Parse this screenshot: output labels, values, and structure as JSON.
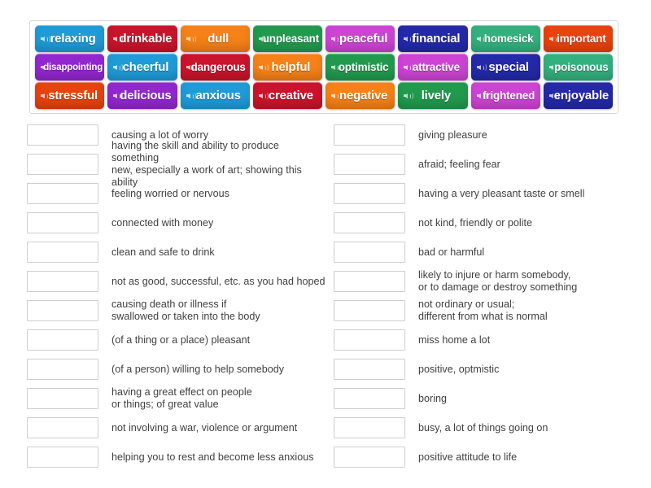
{
  "activity": {
    "type": "match-up",
    "icon_name": "speaker-icon",
    "tile_rows": [
      [
        {
          "label": "relaxing",
          "color": "#1f9bd8",
          "size": "normal"
        },
        {
          "label": "drinkable",
          "color": "#c9142b",
          "size": "normal"
        },
        {
          "label": "dull",
          "color": "#f58118",
          "size": "normal"
        },
        {
          "label": "unpleasant",
          "color": "#219a4e",
          "size": "mid"
        },
        {
          "label": "peaceful",
          "color": "#cd44d4",
          "size": "normal"
        },
        {
          "label": "financial",
          "color": "#2329a8",
          "size": "normal"
        },
        {
          "label": "homesick",
          "color": "#34b07e",
          "size": "mid"
        },
        {
          "label": "important",
          "color": "#e8420e",
          "size": "mid"
        }
      ],
      [
        {
          "label": "disappointing",
          "color": "#9227cf",
          "size": "small"
        },
        {
          "label": "cheerful",
          "color": "#1f9bd8",
          "size": "normal"
        },
        {
          "label": "dangerous",
          "color": "#c9142b",
          "size": "mid"
        },
        {
          "label": "helpful",
          "color": "#f58118",
          "size": "normal"
        },
        {
          "label": "optimistic",
          "color": "#219a4e",
          "size": "mid"
        },
        {
          "label": "attractive",
          "color": "#cd44d4",
          "size": "mid"
        },
        {
          "label": "special",
          "color": "#2329a8",
          "size": "normal"
        },
        {
          "label": "poisonous",
          "color": "#34b07e",
          "size": "mid"
        }
      ],
      [
        {
          "label": "stressful",
          "color": "#e8420e",
          "size": "normal"
        },
        {
          "label": "delicious",
          "color": "#9227cf",
          "size": "normal"
        },
        {
          "label": "anxious",
          "color": "#1f9bd8",
          "size": "normal"
        },
        {
          "label": "creative",
          "color": "#c9142b",
          "size": "normal"
        },
        {
          "label": "negative",
          "color": "#f58118",
          "size": "normal"
        },
        {
          "label": "lively",
          "color": "#219a4e",
          "size": "normal"
        },
        {
          "label": "frightened",
          "color": "#cd44d4",
          "size": "mid"
        },
        {
          "label": "enjoyable",
          "color": "#2329a8",
          "size": "normal"
        }
      ]
    ],
    "definitions_left": [
      {
        "text": "causing a lot of worry"
      },
      {
        "text": "having the skill and ability to produce something\nnew, especially a work of art; showing this ability"
      },
      {
        "text": "feeling worried or nervous"
      },
      {
        "text": "connected with money"
      },
      {
        "text": "clean and safe to drink"
      },
      {
        "text": "not as good, successful, etc. as you had hoped"
      },
      {
        "text": "causing death or illness if\nswallowed or taken into the body"
      },
      {
        "text": "(of a thing or a place) pleasant"
      },
      {
        "text": "(of a person) willing to help somebody"
      },
      {
        "text": "having a great effect on people\nor things; of great value"
      },
      {
        "text": "not involving a war, violence or argument"
      },
      {
        "text": "helping you to rest and become less anxious"
      }
    ],
    "definitions_right": [
      {
        "text": "giving pleasure"
      },
      {
        "text": "afraid; feeling fear"
      },
      {
        "text": "having a very pleasant taste or smell"
      },
      {
        "text": "not kind, friendly or polite"
      },
      {
        "text": "bad or harmful"
      },
      {
        "text": "likely to injure or harm somebody,\nor to damage or destroy something"
      },
      {
        "text": "not ordinary or usual;\ndifferent from what is normal"
      },
      {
        "text": "miss home a lot"
      },
      {
        "text": "positive, optmistic"
      },
      {
        "text": "boring"
      },
      {
        "text": "busy, a lot of things going on"
      },
      {
        "text": "positive attitude to life"
      }
    ]
  }
}
